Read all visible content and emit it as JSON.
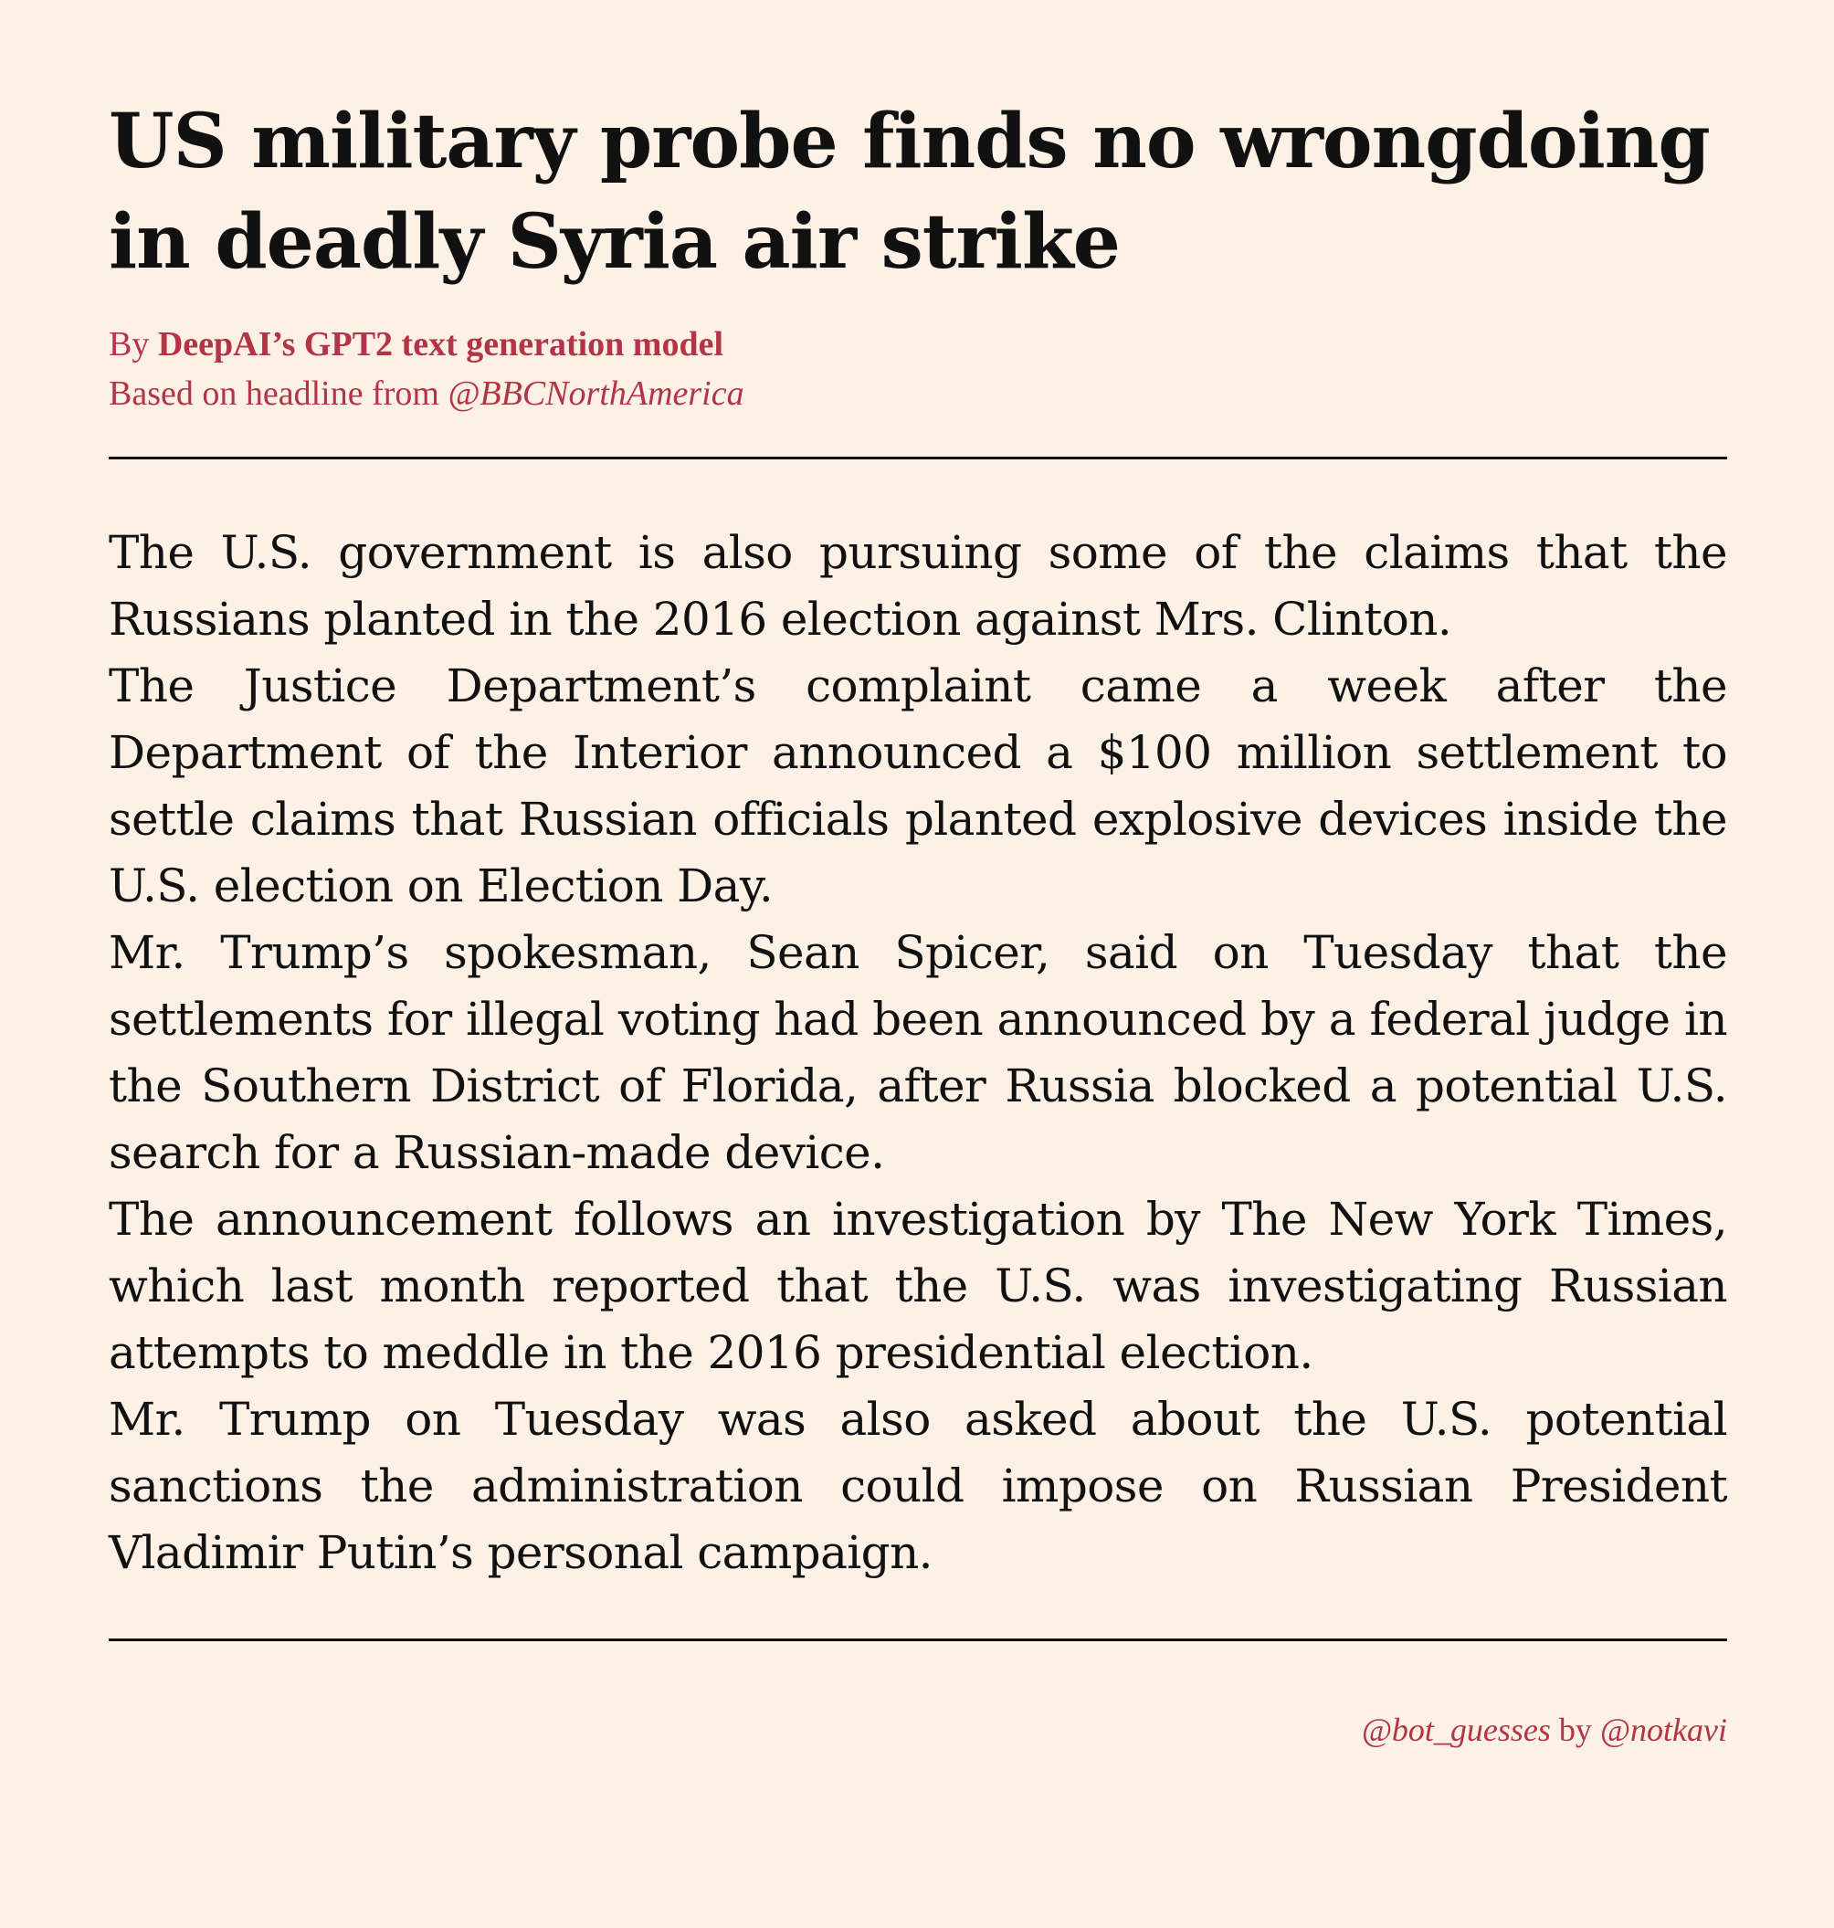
{
  "article": {
    "headline": "US military probe finds no wrongdoing in deadly Syria air strike",
    "byline": {
      "prefix": "By ",
      "author": "DeepAI’s GPT2 text generation model",
      "based_on_prefix": "Based on headline from ",
      "source_handle": "@BBCNorthAmerica"
    },
    "paragraphs": [
      "The U.S. government is also pursuing some of the claims that the Russians planted in the 2016 election against Mrs. Clinton.",
      "The Justice Department’s complaint came a week after the Department of the Interior announced a $100 million settlement to settle claims that Russian officials planted explosive devices inside the U.S. election on Election Day.",
      "Mr. Trump’s spokesman, Sean Spicer, said on Tuesday that the settlements for illegal voting had been announced by a federal judge in the Southern District of Florida, after Russia blocked a potential U.S. search for a Russian-made device.",
      "The announcement follows an investigation by The New York Times, which last month reported that the U.S. was investigating Russian attempts to meddle in the 2016 presidential election.",
      "Mr. Trump on Tuesday was also asked about the U.S. potential sanctions the administration could impose on Russian President Vladimir Putin’s personal campaign."
    ]
  },
  "footer": {
    "bot_handle": "@bot_guesses",
    "by_text": " by ",
    "author_handle": "@notkavi"
  },
  "colors": {
    "background": "#fdf1e6",
    "text": "#111111",
    "accent": "#b33446"
  }
}
